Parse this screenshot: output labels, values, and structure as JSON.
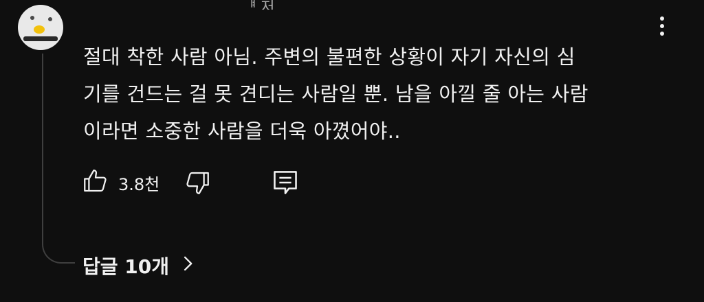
{
  "comment": {
    "author_partial": "ᅵᅧ 저",
    "text_lines": [
      "절대 착한 사람 아님. 주변의 불편한 상황이 자기 자신의 심",
      "기를 건드는 걸 못 견디는 사람일 뿐. 남을 아낄 줄 아는 사람",
      "이라면 소중한 사람을 더욱 아꼈어야.."
    ],
    "like_count": "3.8천",
    "replies_label": "답글 10개"
  },
  "icons": {
    "menu": "more-vertical-icon",
    "like": "thumbs-up-icon",
    "dislike": "thumbs-down-icon",
    "reply": "comment-reply-icon",
    "expand": "chevron-right-icon"
  },
  "colors": {
    "background": "#0f0f0f",
    "text": "#f1f1f1",
    "thread_line": "#3f3f3f"
  }
}
